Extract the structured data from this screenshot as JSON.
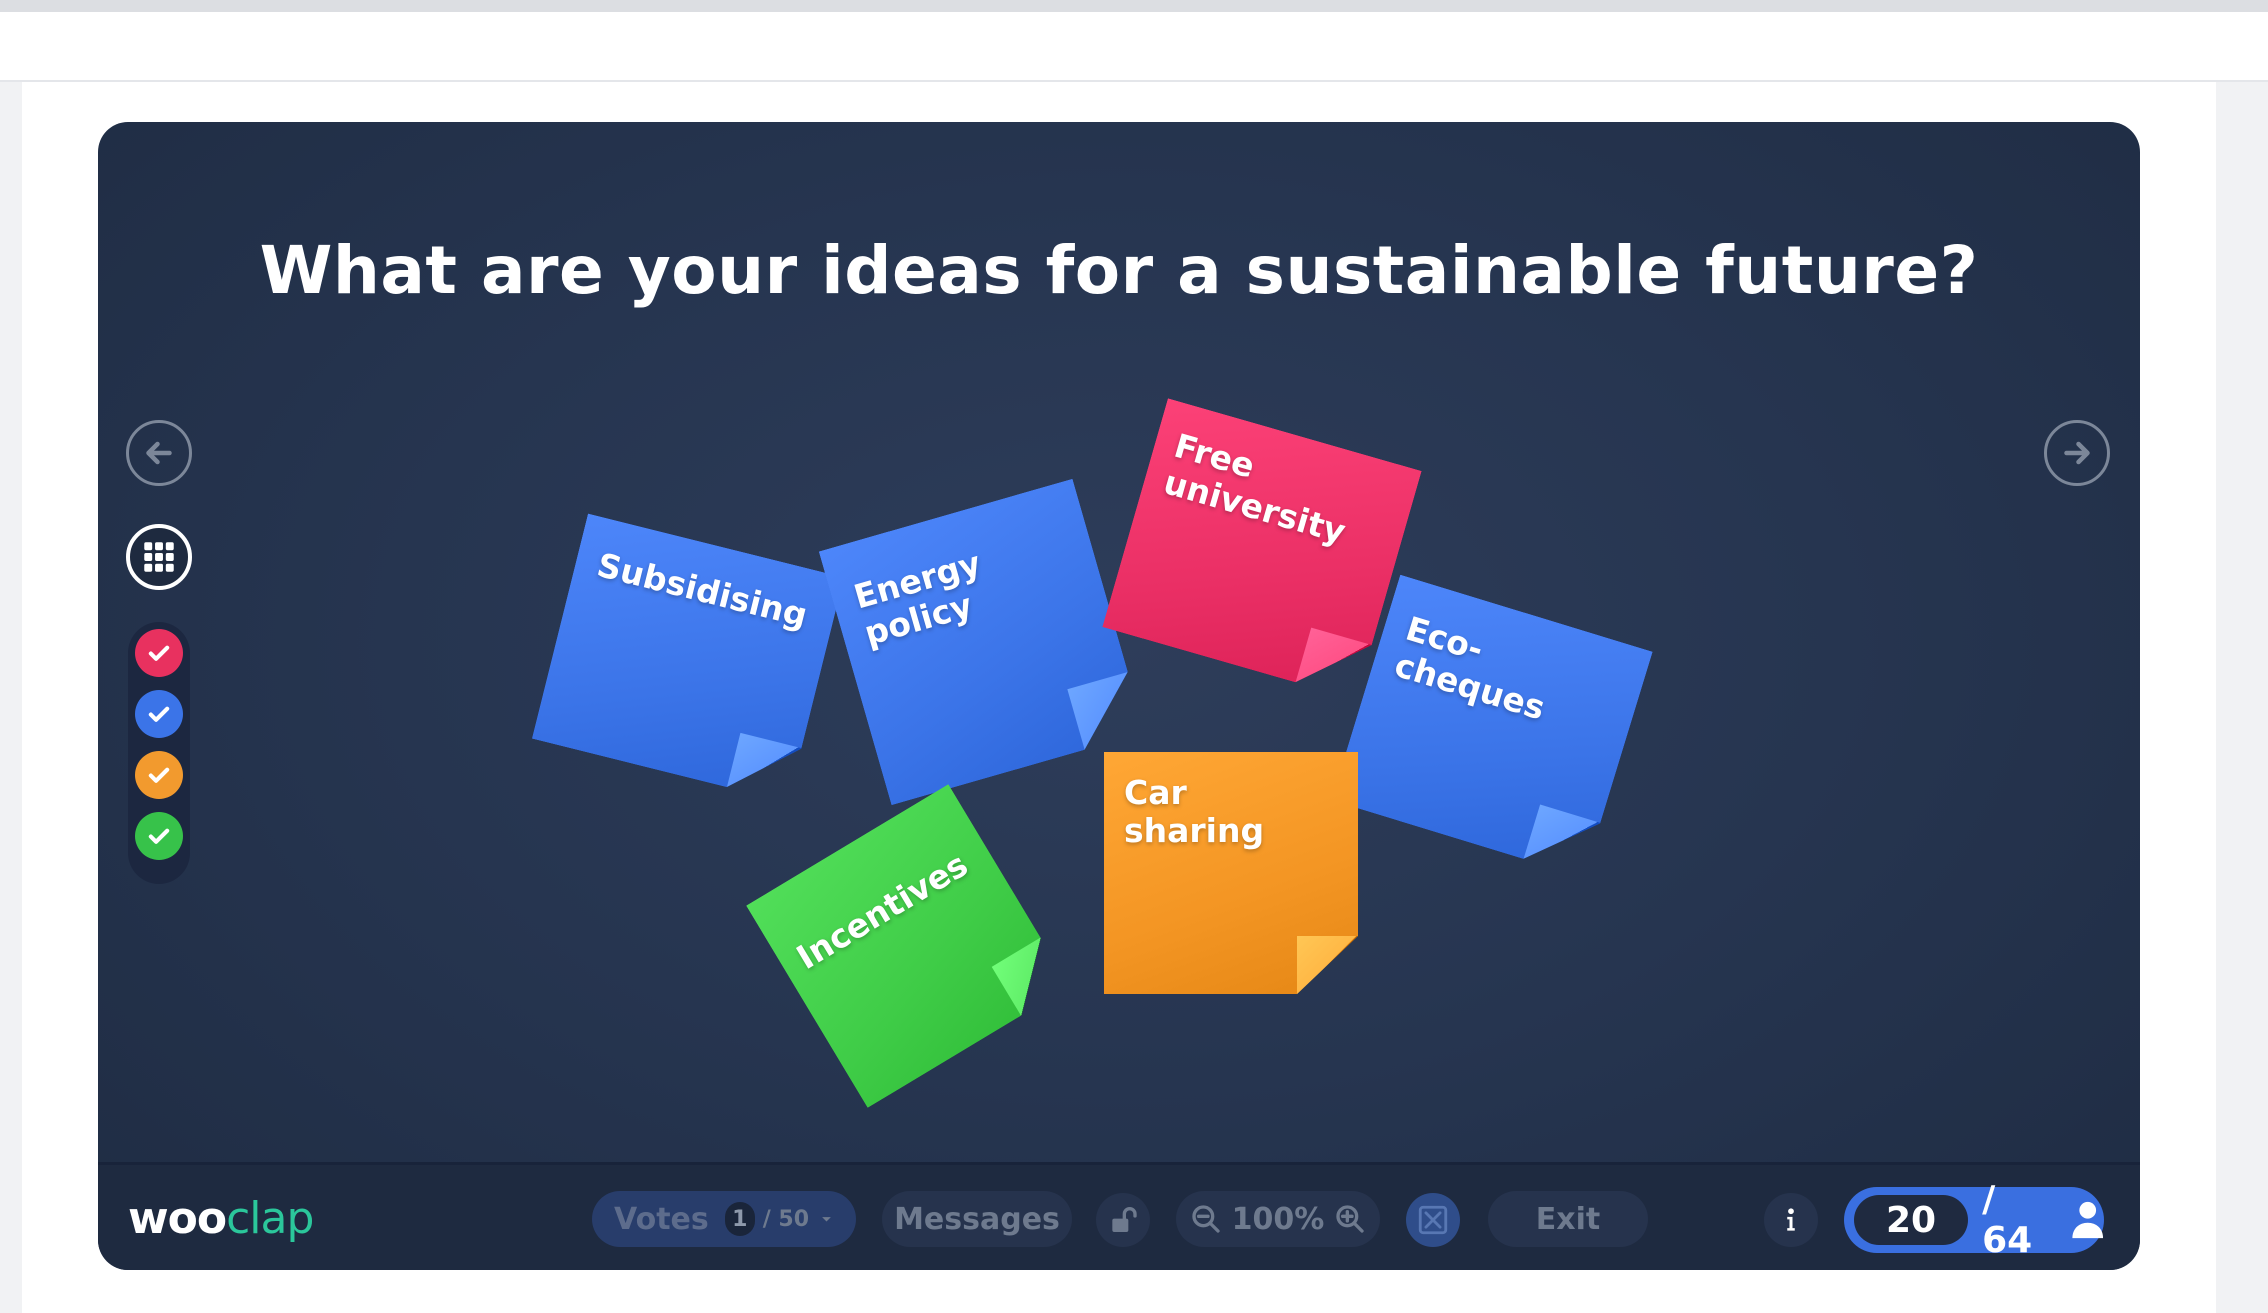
{
  "question": "What are your ideas for a sustainable future?",
  "ideas": [
    {
      "text": "Subsidising",
      "color": "#3b74e8"
    },
    {
      "text": "Energy policy",
      "color": "#3b74e8"
    },
    {
      "text": "Free university",
      "color": "#ea2f65"
    },
    {
      "text": "Eco-cheques",
      "color": "#3b74e8"
    },
    {
      "text": "Incentives",
      "color": "#3fcc47"
    },
    {
      "text": "Car sharing",
      "color": "#f39523"
    }
  ],
  "filters": [
    {
      "icon": "check-icon",
      "color": "#e8315f"
    },
    {
      "icon": "check-icon",
      "color": "#3b74e8"
    },
    {
      "icon": "check-icon",
      "color": "#f29a2e"
    },
    {
      "icon": "check-icon",
      "color": "#37c24a"
    }
  ],
  "logo": {
    "part1": "woo",
    "part2": "clap"
  },
  "toolbar": {
    "votes_label": "Votes",
    "votes_current": "1",
    "votes_total": "/ 50",
    "messages_label": "Messages",
    "zoom": "100%",
    "exit_label": "Exit"
  },
  "participants": {
    "current": "20",
    "total": "/ 64"
  }
}
